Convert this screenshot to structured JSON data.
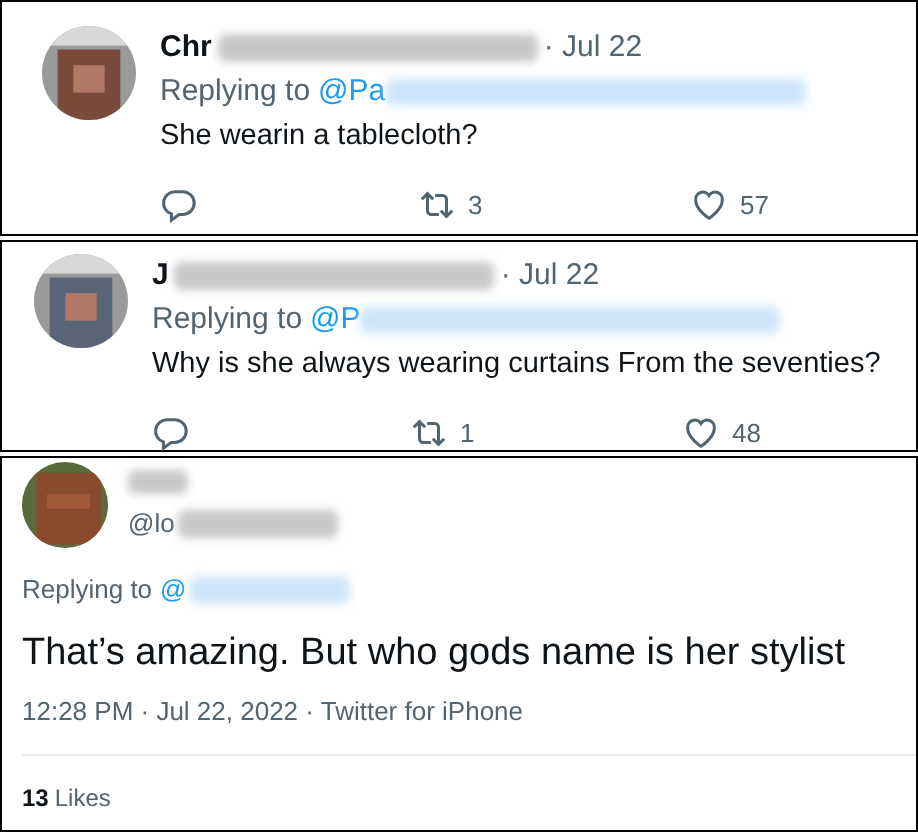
{
  "replies": [
    {
      "name": "Chr",
      "date": "· Jul 22",
      "replying_label": "Replying to",
      "replying_handle": "@Pa",
      "text": "She wearin a tablecloth?",
      "retweets": "3",
      "likes": "57"
    },
    {
      "name": "J",
      "date": "· Jul 22",
      "replying_label": "Replying to",
      "replying_handle": "@P",
      "text": "Why is she always wearing curtains From the seventies?",
      "retweets": "1",
      "likes": "48"
    }
  ],
  "main_tweet": {
    "handle": "@lo",
    "replying_label": "Replying to",
    "replying_handle": "@",
    "text": "That’s amazing. But who gods name is her stylist",
    "timestamp": "12:28 PM · Jul 22, 2022 · Twitter for iPhone",
    "likes_count": "13",
    "likes_label": "Likes"
  }
}
